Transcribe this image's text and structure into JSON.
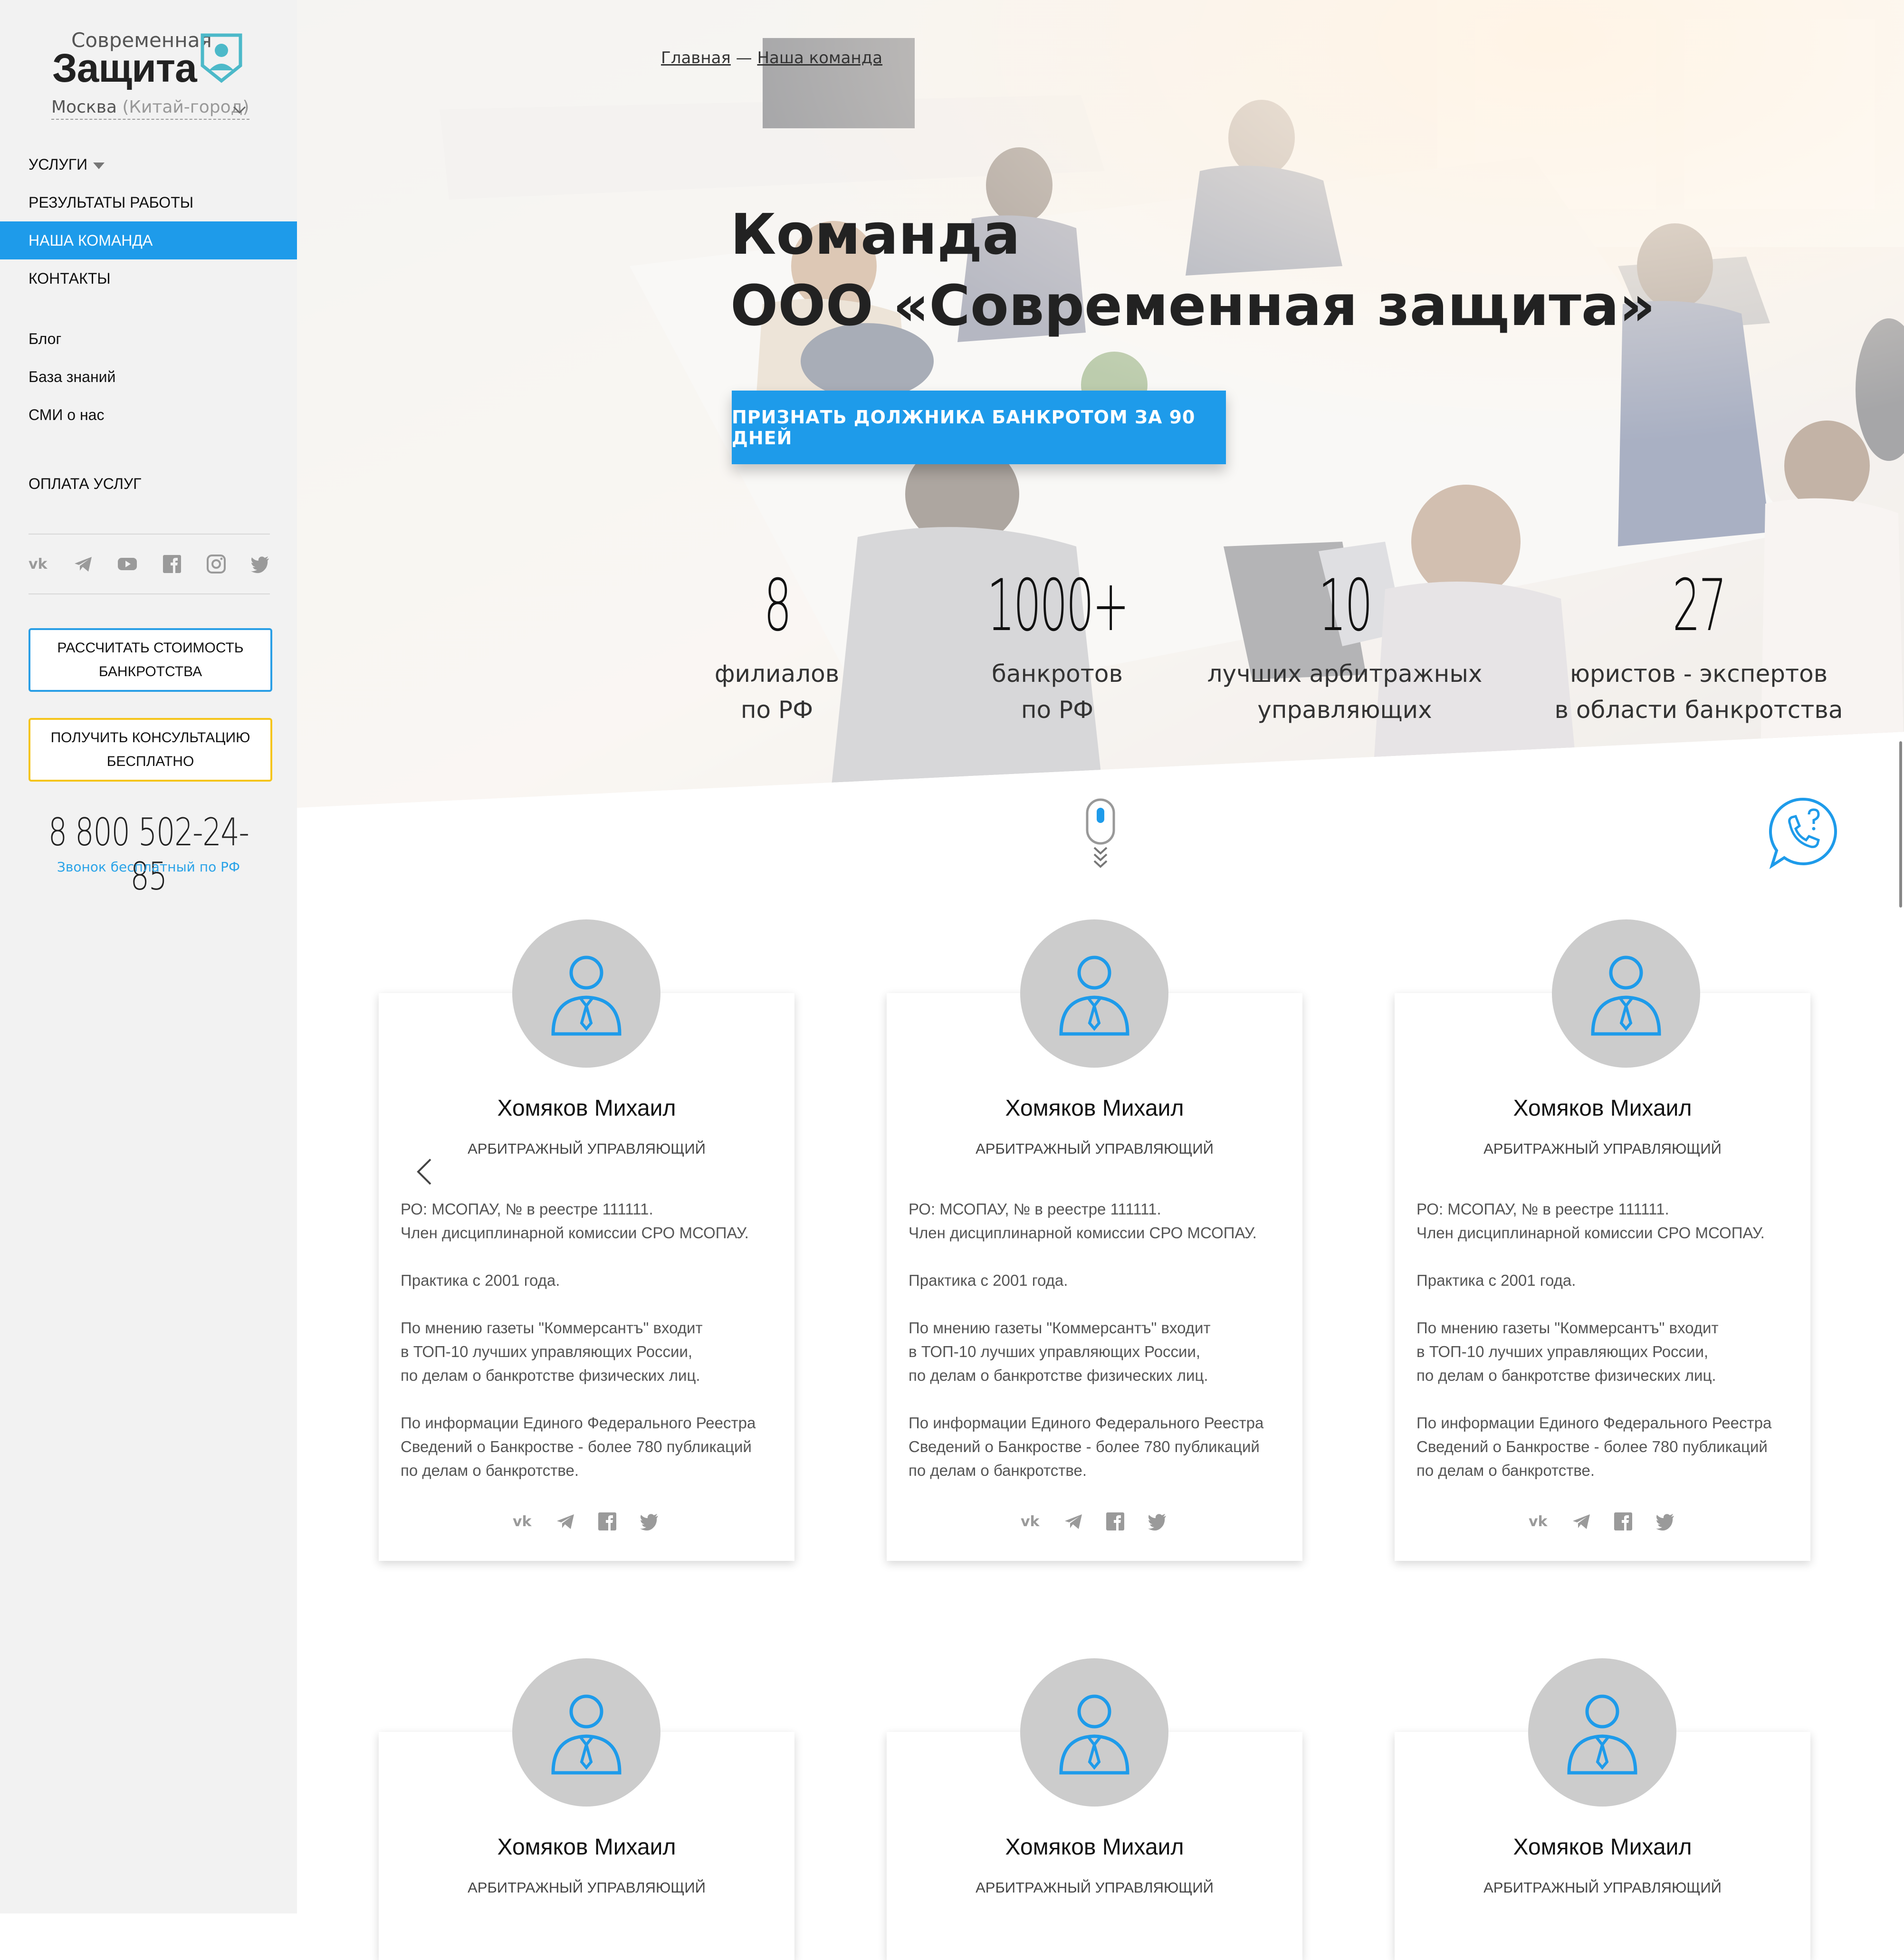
{
  "brand": {
    "name_top": "Современная",
    "name_main": "Защита"
  },
  "city": {
    "name": "Москва",
    "district": "(Китай-город)"
  },
  "nav": {
    "main": [
      {
        "label": "Услуги",
        "has_dropdown": true
      },
      {
        "label": "Результаты работы"
      },
      {
        "label": "Наша команда",
        "active": true
      },
      {
        "label": "Контакты"
      }
    ],
    "secondary": [
      {
        "label": "Блог"
      },
      {
        "label": "База знаний"
      },
      {
        "label": "СМИ о нас"
      }
    ],
    "payment": "Оплата услуг"
  },
  "sidebar_socials": [
    "vk-icon",
    "telegram-icon",
    "youtube-icon",
    "facebook-icon",
    "instagram-icon",
    "twitter-icon"
  ],
  "buttons": {
    "calc": "Рассчитать стоимость банкротства",
    "consult": "Получить консультацию бесплатно"
  },
  "phone": {
    "number": "8 800 502-24-85",
    "note": "Звонок бесплатный по РФ"
  },
  "breadcrumbs": {
    "home": "Главная",
    "separator": "—",
    "current": "Наша команда"
  },
  "hero": {
    "title_line1": "Команда",
    "title_line2": "ООО «Современная защита»",
    "cta": "ПРИЗНАТЬ ДОЛЖНИКА БАНКРОТОМ ЗА 90 ДНЕЙ"
  },
  "stats": [
    {
      "value": "8",
      "line1": "филиалов",
      "line2": "по РФ"
    },
    {
      "value": "1000+",
      "line1": "банкротов",
      "line2": "по РФ"
    },
    {
      "value": "10",
      "line1": "лучших арбитражных",
      "line2": "управляющих"
    },
    {
      "value": "27",
      "line1": "юристов - экспертов",
      "line2": "в области банкротства"
    }
  ],
  "team": {
    "member": {
      "name": "Хомяков Михаил",
      "role": "АРБИТРАЖНЫЙ УПРАВЛЯЮЩИЙ",
      "bio_1": "РО: МСОПАУ, № в реестре 111111.\nЧлен дисциплинарной комиссии СРО МСОПАУ.",
      "bio_2": "Практика с 2001 года.",
      "bio_3": "По мнению газеты \"Коммерсантъ\" входит\nв ТОП-10 лучших управляющих России,\nпо делам о банкротстве физических лиц.",
      "bio_4": "По информации Единого Федерального Реестра\nСведений о Банкростве - более 780 публикаций\nпо делам о банкротстве."
    },
    "card_socials": [
      "vk-icon",
      "telegram-icon",
      "facebook-icon",
      "twitter-icon"
    ]
  },
  "colors": {
    "accent": "#1e9bea",
    "yellow": "#f5c51c",
    "sidebar_bg": "#f2f2f2",
    "avatar_bg": "#cccccc"
  }
}
